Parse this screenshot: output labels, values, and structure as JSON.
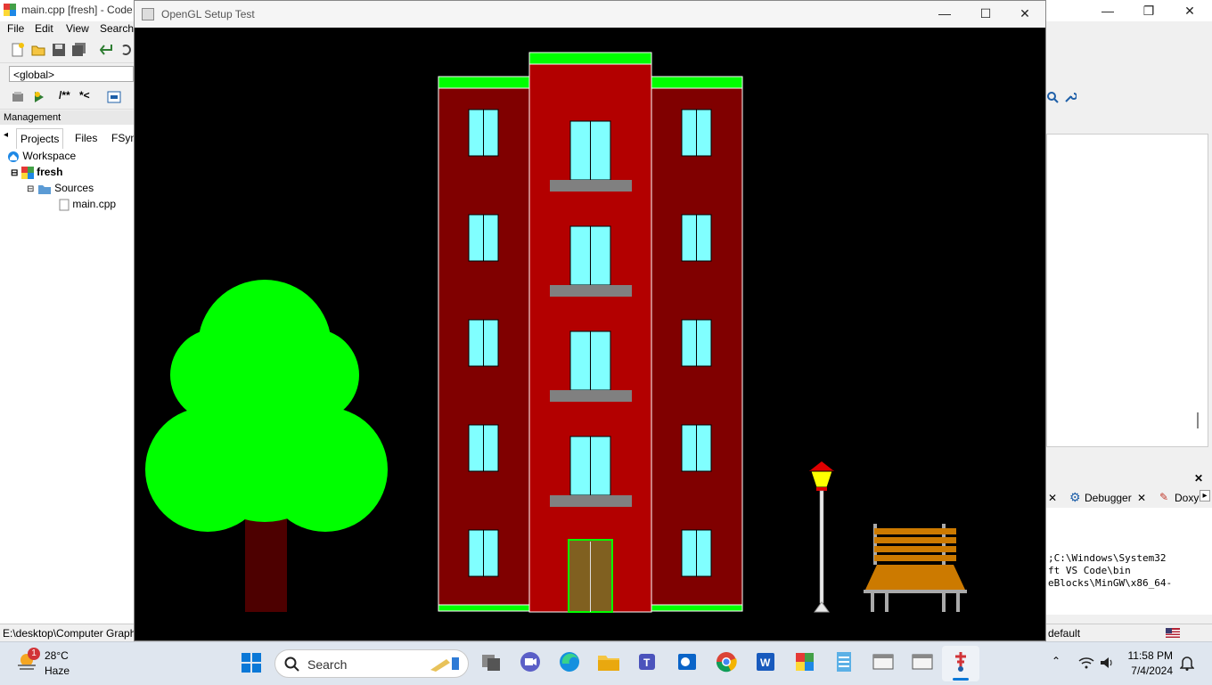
{
  "ide": {
    "title": "main.cpp [fresh] - Code",
    "menu": [
      "File",
      "Edit",
      "View",
      "Search"
    ],
    "scope_value": "<global>",
    "doc_buttons": [
      "/**",
      "*<"
    ],
    "management": {
      "title": "Management",
      "tabs": [
        "Projects",
        "Files",
        "FSym"
      ],
      "tree": {
        "workspace": "Workspace",
        "project": "fresh",
        "folder": "Sources",
        "file": "main.cpp"
      }
    },
    "status_path": "E:\\desktop\\Computer Graph",
    "status_right": "default",
    "log_tabs": [
      "Debugger",
      "Doxy"
    ],
    "log_lines": [
      ";C:\\Windows\\System32",
      "ft VS Code\\bin",
      "eBlocks\\MinGW\\x86_64-"
    ]
  },
  "gl_window": {
    "title": "OpenGL Setup Test"
  },
  "scene_colors": {
    "background": "#000000",
    "building_wing": "#800000",
    "building_center": "#b30000",
    "trim": "#00ff00",
    "window_glass": "#80ffff",
    "balcony": "#808080",
    "door": "#806020",
    "tree_leaves": "#00ff00",
    "tree_trunk": "#4d0000",
    "bench": "#cc7a00",
    "lamp_cap": "#e00000",
    "lamp_light": "#ffff00"
  },
  "taskbar": {
    "weather_temp": "28°C",
    "weather_desc": "Haze",
    "weather_badge": "1",
    "search_placeholder": "Search",
    "time": "11:58 PM",
    "date": "7/4/2024"
  }
}
